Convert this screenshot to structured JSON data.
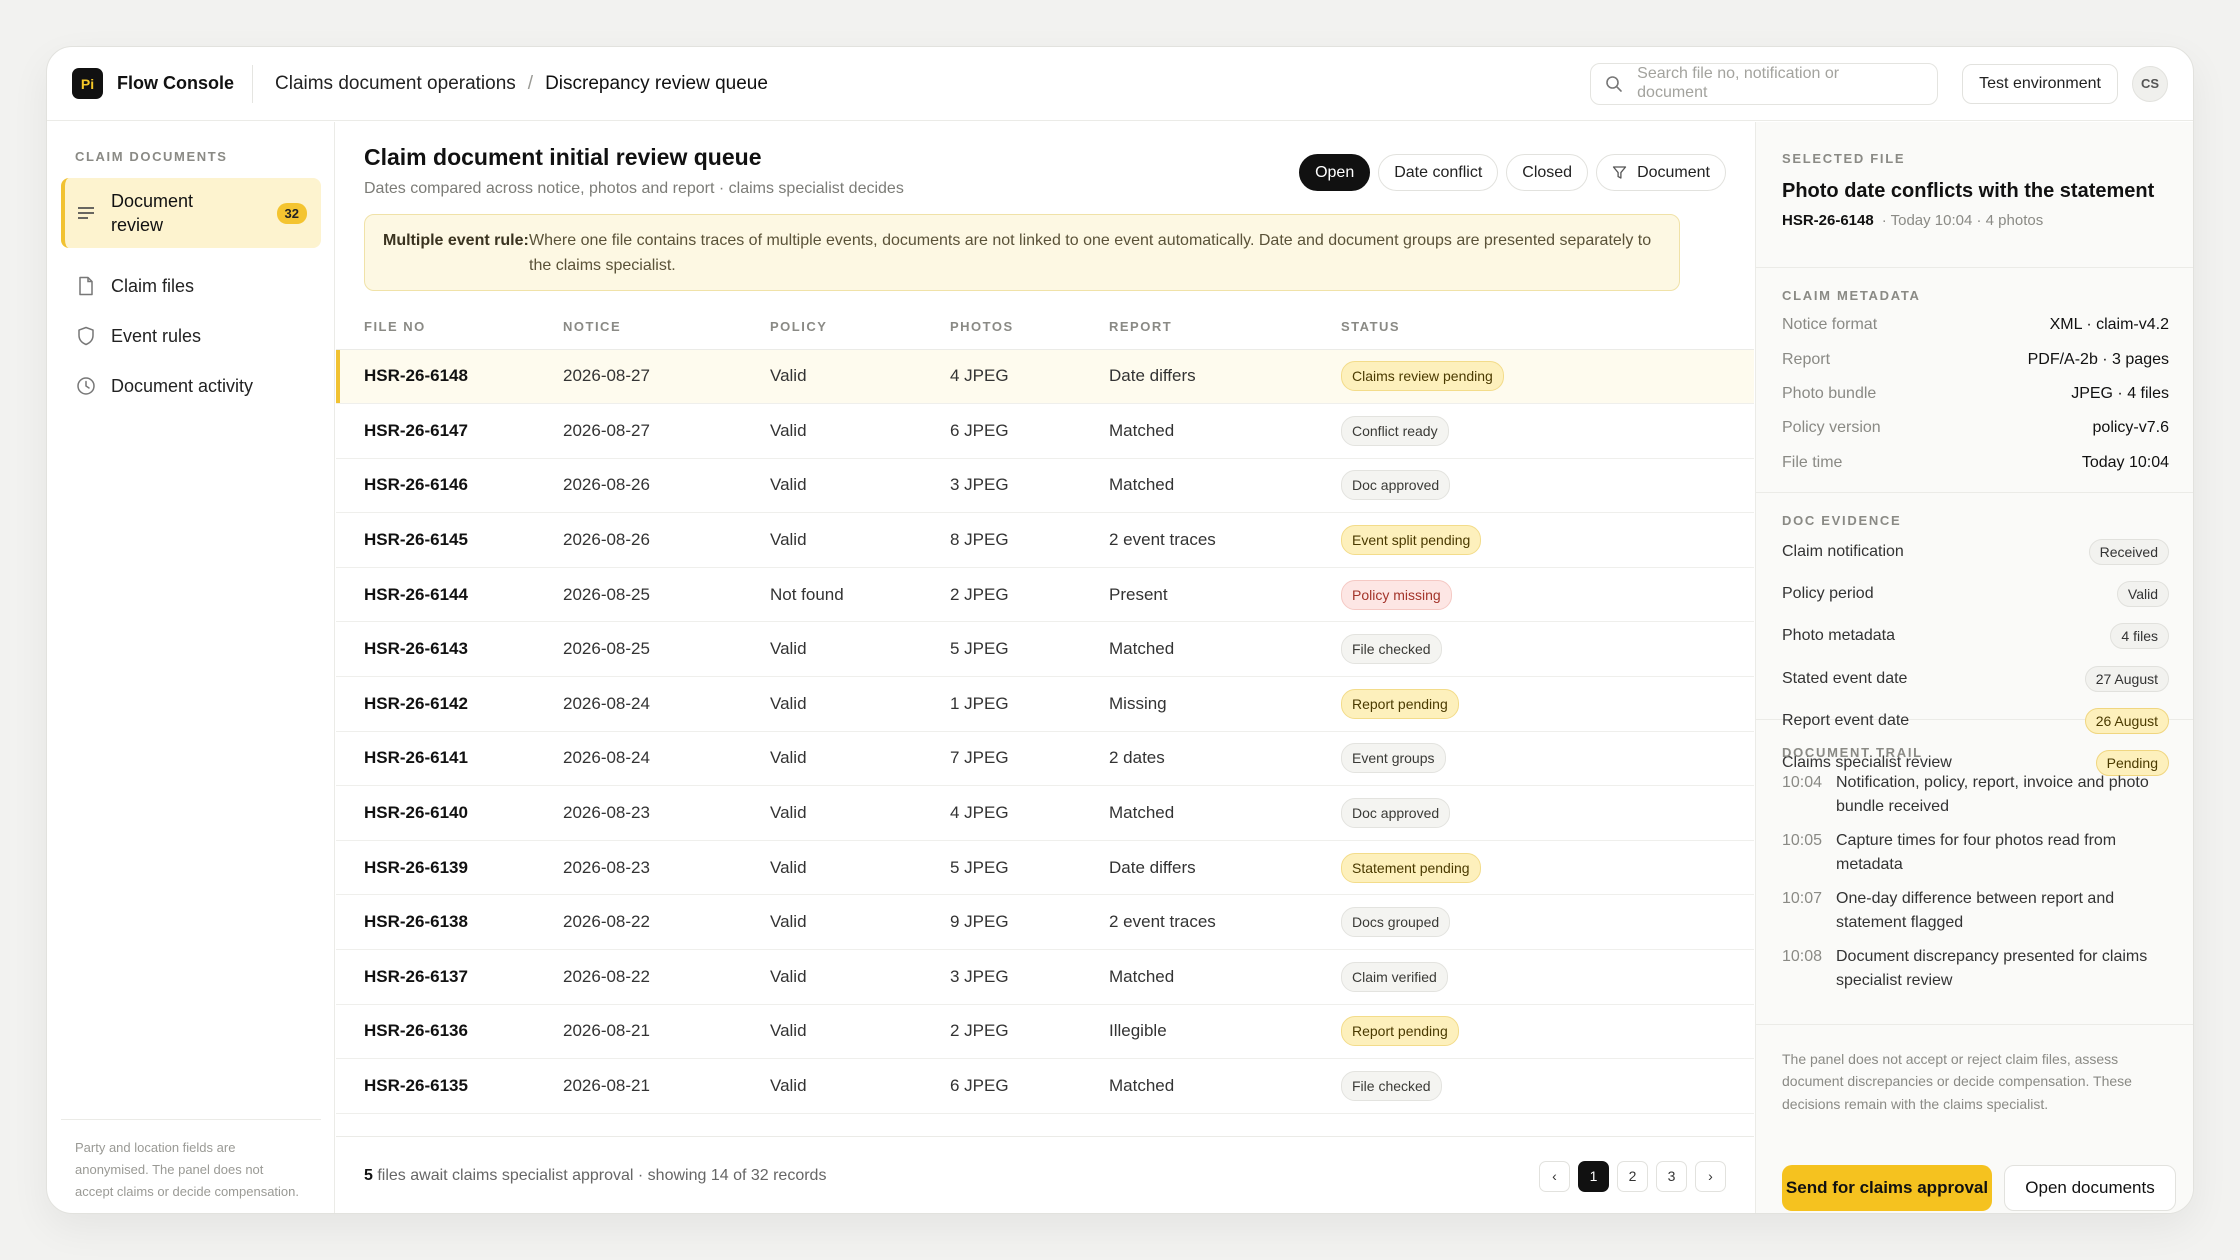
{
  "app": {
    "logo": "Pi",
    "name": "Flow Console"
  },
  "breadcrumb": {
    "parent": "Claims document operations",
    "separator": "/",
    "current": "Discrepancy review queue"
  },
  "search": {
    "placeholder": "Search file no, notification or document"
  },
  "env_button": "Test environment",
  "avatar": "CS",
  "sidebar": {
    "title": "CLAIM DOCUMENTS",
    "items": [
      {
        "label": "Document review",
        "badge": "32",
        "icon": "list-icon"
      },
      {
        "label": "Claim files",
        "icon": "file-icon"
      },
      {
        "label": "Event rules",
        "icon": "shield-icon"
      },
      {
        "label": "Document activity",
        "icon": "clock-icon"
      }
    ],
    "note": "Party and location fields are anonymised. The panel does not accept claims or decide compensation."
  },
  "main": {
    "title": "Claim document initial review queue",
    "subtitle": "Dates compared across notice, photos and report · claims specialist decides",
    "filters": [
      "Open",
      "Date conflict",
      "Closed",
      "Document"
    ],
    "rule": {
      "label": "Multiple event rule:",
      "text": "Where one file contains traces of multiple events, documents are not linked to one event automatically. Date and document groups are presented separately to the claims specialist."
    },
    "columns": [
      "FILE NO",
      "NOTICE",
      "POLICY",
      "PHOTOS",
      "REPORT",
      "STATUS"
    ],
    "rows": [
      {
        "file": "HSR-26-6148",
        "notice": "2026-08-27",
        "policy": "Valid",
        "photos": "4 JPEG",
        "report": "Date differs",
        "status": "Claims review pending",
        "tone": "warn"
      },
      {
        "file": "HSR-26-6147",
        "notice": "2026-08-27",
        "policy": "Valid",
        "photos": "6 JPEG",
        "report": "Matched",
        "status": "Conflict ready",
        "tone": "neutral"
      },
      {
        "file": "HSR-26-6146",
        "notice": "2026-08-26",
        "policy": "Valid",
        "photos": "3 JPEG",
        "report": "Matched",
        "status": "Doc approved",
        "tone": "neutral"
      },
      {
        "file": "HSR-26-6145",
        "notice": "2026-08-26",
        "policy": "Valid",
        "photos": "8 JPEG",
        "report": "2 event traces",
        "status": "Event split pending",
        "tone": "warn"
      },
      {
        "file": "HSR-26-6144",
        "notice": "2026-08-25",
        "policy": "Not found",
        "photos": "2 JPEG",
        "report": "Present",
        "status": "Policy missing",
        "tone": "err"
      },
      {
        "file": "HSR-26-6143",
        "notice": "2026-08-25",
        "policy": "Valid",
        "photos": "5 JPEG",
        "report": "Matched",
        "status": "File checked",
        "tone": "neutral"
      },
      {
        "file": "HSR-26-6142",
        "notice": "2026-08-24",
        "policy": "Valid",
        "photos": "1 JPEG",
        "report": "Missing",
        "status": "Report pending",
        "tone": "warn"
      },
      {
        "file": "HSR-26-6141",
        "notice": "2026-08-24",
        "policy": "Valid",
        "photos": "7 JPEG",
        "report": "2 dates",
        "status": "Event groups",
        "tone": "neutral"
      },
      {
        "file": "HSR-26-6140",
        "notice": "2026-08-23",
        "policy": "Valid",
        "photos": "4 JPEG",
        "report": "Matched",
        "status": "Doc approved",
        "tone": "neutral"
      },
      {
        "file": "HSR-26-6139",
        "notice": "2026-08-23",
        "policy": "Valid",
        "photos": "5 JPEG",
        "report": "Date differs",
        "status": "Statement pending",
        "tone": "warn"
      },
      {
        "file": "HSR-26-6138",
        "notice": "2026-08-22",
        "policy": "Valid",
        "photos": "9 JPEG",
        "report": "2 event traces",
        "status": "Docs grouped",
        "tone": "neutral"
      },
      {
        "file": "HSR-26-6137",
        "notice": "2026-08-22",
        "policy": "Valid",
        "photos": "3 JPEG",
        "report": "Matched",
        "status": "Claim verified",
        "tone": "neutral"
      },
      {
        "file": "HSR-26-6136",
        "notice": "2026-08-21",
        "policy": "Valid",
        "photos": "2 JPEG",
        "report": "Illegible",
        "status": "Report pending",
        "tone": "warn"
      },
      {
        "file": "HSR-26-6135",
        "notice": "2026-08-21",
        "policy": "Valid",
        "photos": "6 JPEG",
        "report": "Matched",
        "status": "File checked",
        "tone": "neutral"
      }
    ],
    "footer": {
      "count": "5",
      "text": " files await claims specialist approval · showing 14 of 32 records"
    },
    "pager": [
      "‹",
      "1",
      "2",
      "3",
      "›"
    ]
  },
  "panel": {
    "selected": {
      "title": "SELECTED FILE",
      "heading": "Photo date conflicts with the statement",
      "file": "HSR-26-6148",
      "meta": "· Today 10:04 · 4 photos"
    },
    "metadata": {
      "title": "CLAIM METADATA",
      "items": [
        {
          "k": "Notice format",
          "v": "XML · claim-v4.2"
        },
        {
          "k": "Report",
          "v": "PDF/A-2b · 3 pages"
        },
        {
          "k": "Photo bundle",
          "v": "JPEG · 4 files"
        },
        {
          "k": "Policy version",
          "v": "policy-v7.6"
        },
        {
          "k": "File time",
          "v": "Today 10:04"
        }
      ]
    },
    "evidence": {
      "title": "DOC EVIDENCE",
      "items": [
        {
          "k": "Claim notification",
          "v": "Received",
          "tone": "neutral"
        },
        {
          "k": "Policy period",
          "v": "Valid",
          "tone": "neutral"
        },
        {
          "k": "Photo metadata",
          "v": "4 files",
          "tone": "neutral"
        },
        {
          "k": "Stated event date",
          "v": "27 August",
          "tone": "neutral"
        },
        {
          "k": "Report event date",
          "v": "26 August",
          "tone": "warn"
        },
        {
          "k": "Claims specialist review",
          "v": "Pending",
          "tone": "warn"
        }
      ]
    },
    "trail": {
      "title": "DOCUMENT TRAIL",
      "items": [
        {
          "t": "10:04",
          "d": "Notification, policy, report, invoice and photo bundle received"
        },
        {
          "t": "10:05",
          "d": "Capture times for four photos read from metadata"
        },
        {
          "t": "10:07",
          "d": "One-day difference between report and statement flagged"
        },
        {
          "t": "10:08",
          "d": "Document discrepancy presented for claims specialist review"
        }
      ]
    },
    "note": "The panel does not accept or reject claim files, assess document discrepancies or decide compensation. These decisions remain with the claims specialist.",
    "primary": "Send for claims approval",
    "secondary": "Open documents"
  }
}
